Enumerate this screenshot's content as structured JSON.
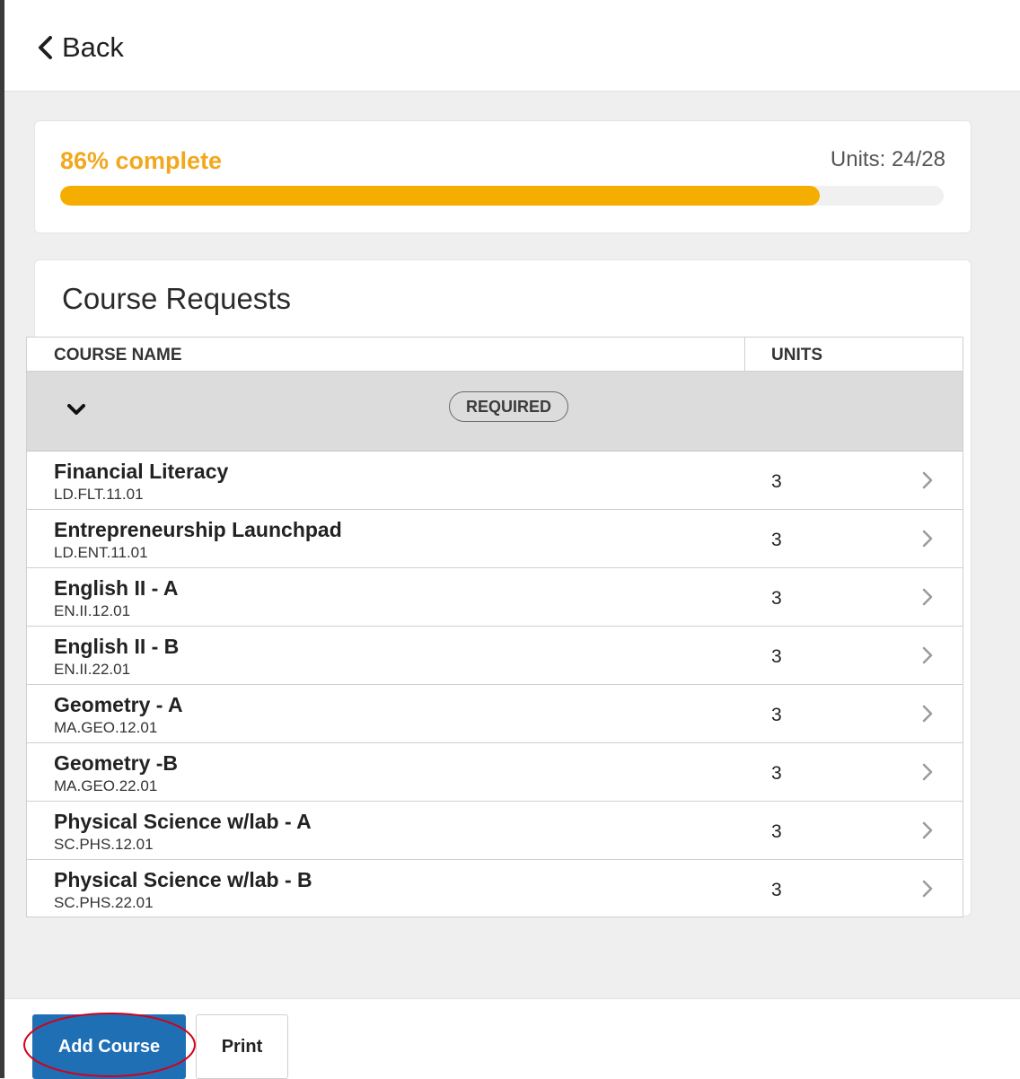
{
  "header": {
    "back_label": "Back",
    "back_icon": "chevron-left-icon"
  },
  "progress": {
    "complete_label": "86% complete",
    "percent": 86,
    "units_label": "Units: 24/28",
    "accent_color": "#f5ad00"
  },
  "requests": {
    "title": "Course Requests",
    "columns": {
      "name": "COURSE NAME",
      "units": "UNITS"
    },
    "group": {
      "label": "REQUIRED",
      "toggle_icon": "chevron-down-icon"
    },
    "rows": [
      {
        "name": "Financial Literacy",
        "code": "LD.FLT.11.01",
        "units": "3"
      },
      {
        "name": "Entrepreneurship Launchpad",
        "code": "LD.ENT.11.01",
        "units": "3"
      },
      {
        "name": "English II - A",
        "code": "EN.II.12.01",
        "units": "3"
      },
      {
        "name": "English II - B",
        "code": "EN.II.22.01",
        "units": "3"
      },
      {
        "name": "Geometry - A",
        "code": "MA.GEO.12.01",
        "units": "3"
      },
      {
        "name": "Geometry -B",
        "code": "MA.GEO.22.01",
        "units": "3"
      },
      {
        "name": "Physical Science w/lab - A",
        "code": "SC.PHS.12.01",
        "units": "3"
      },
      {
        "name": "Physical Science w/lab - B",
        "code": "SC.PHS.22.01",
        "units": "3"
      }
    ],
    "row_icon": "chevron-right-icon"
  },
  "footer": {
    "add_course_label": "Add Course",
    "print_label": "Print",
    "primary_color": "#1f6fb5",
    "annotation_color": "#d0021b"
  }
}
